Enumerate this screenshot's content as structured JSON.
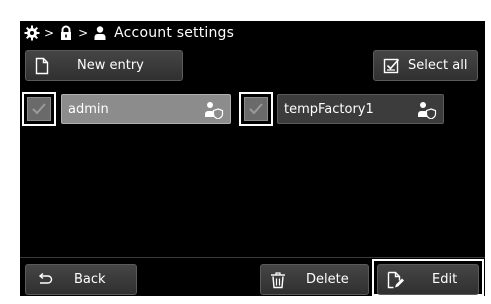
{
  "titlebar": {
    "title": "Account settings",
    "sep1": ">",
    "sep2": ">"
  },
  "toolbar": {
    "new_entry_label": "New entry",
    "select_all_label": "Select all"
  },
  "accounts": [
    {
      "name": "admin",
      "checked": true,
      "selected": true
    },
    {
      "name": "tempFactory1",
      "checked": true,
      "selected": false
    }
  ],
  "footer": {
    "back_label": "Back",
    "delete_label": "Delete",
    "edit_label": "Edit"
  },
  "colors": {
    "background": "#000000",
    "button": "#3c3c3c",
    "selected_entry": "#8c8c8c",
    "text": "#ffffff"
  },
  "icons": [
    "gear-icon",
    "lock-icon",
    "user-icon",
    "document-icon",
    "checklist-icon",
    "user-shield-icon",
    "back-arrow-icon",
    "trash-icon",
    "edit-document-icon"
  ]
}
